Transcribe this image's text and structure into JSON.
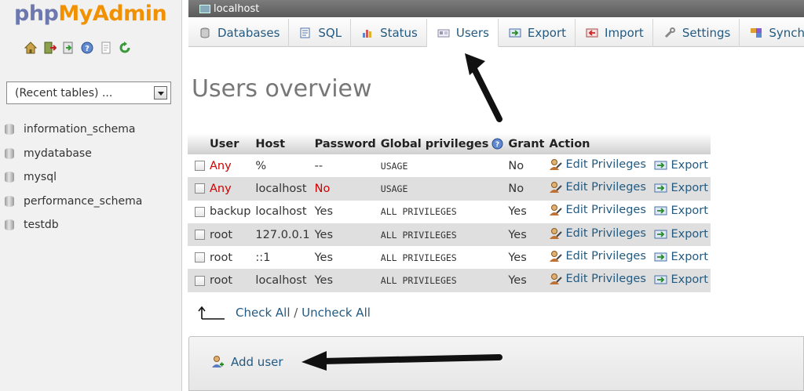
{
  "sidebar": {
    "logo_php": "php",
    "logo_myadmin": "MyAdmin",
    "icons": [
      "home-icon",
      "exit-icon",
      "query-icon",
      "docs-icon",
      "sql-docs-icon",
      "reload-icon"
    ],
    "recent_tables": "(Recent tables) ...",
    "databases": [
      "information_schema",
      "mydatabase",
      "mysql",
      "performance_schema",
      "testdb"
    ]
  },
  "server_bar": {
    "label": "localhost"
  },
  "tabs": [
    {
      "label": "Databases",
      "icon": "database-icon"
    },
    {
      "label": "SQL",
      "icon": "sql-icon"
    },
    {
      "label": "Status",
      "icon": "status-icon"
    },
    {
      "label": "Users",
      "icon": "users-icon"
    },
    {
      "label": "Export",
      "icon": "export-icon"
    },
    {
      "label": "Import",
      "icon": "import-icon"
    },
    {
      "label": "Settings",
      "icon": "settings-icon"
    },
    {
      "label": "Synchron",
      "icon": "sync-icon"
    }
  ],
  "page_title": "Users overview",
  "table": {
    "headers": [
      "User",
      "Host",
      "Password",
      "Global privileges",
      "Grant",
      "Action"
    ],
    "rows": [
      {
        "user": "Any",
        "host": "%",
        "password": "--",
        "privileges": "USAGE",
        "grant": "No"
      },
      {
        "user": "Any",
        "host": "localhost",
        "password": "No",
        "privileges": "USAGE",
        "grant": "No"
      },
      {
        "user": "backup",
        "host": "localhost",
        "password": "Yes",
        "privileges": "ALL PRIVILEGES",
        "grant": "Yes"
      },
      {
        "user": "root",
        "host": "127.0.0.1",
        "password": "Yes",
        "privileges": "ALL PRIVILEGES",
        "grant": "Yes"
      },
      {
        "user": "root",
        "host": "::1",
        "password": "Yes",
        "privileges": "ALL PRIVILEGES",
        "grant": "Yes"
      },
      {
        "user": "root",
        "host": "localhost",
        "password": "Yes",
        "privileges": "ALL PRIVILEGES",
        "grant": "Yes"
      }
    ],
    "edit_label": "Edit Privileges",
    "export_label": "Export"
  },
  "check_all": "Check All",
  "separator": "/",
  "uncheck_all": "Uncheck All",
  "add_user": "Add user",
  "colors": {
    "link": "#235a81",
    "red": "#d00000",
    "logo_php": "#6c78af",
    "logo_myadmin": "#f29100"
  }
}
